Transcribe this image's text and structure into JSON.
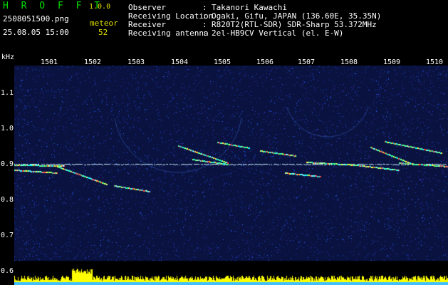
{
  "header": {
    "app_name": "H R O F F T",
    "version": "1.0.0",
    "filename": "2508051500.png",
    "datetime": "25.08.05 15:00",
    "meteor_label": "meteor",
    "meteor_count": "52",
    "info": [
      {
        "key": "Observer",
        "value": "Takanori Kawachi"
      },
      {
        "key": "Receiving Location",
        "value": "Ogaki, Gifu, JAPAN (136.60E, 35.35N)"
      },
      {
        "key": "Receiver",
        "value": "R820T2(RTL-SDR) SDR-Sharp 53.372MHz"
      },
      {
        "key": "Receiving antenna",
        "value": "2el-HB9CV Vertical (el. E-W)"
      }
    ],
    "separator": ":"
  },
  "axis": {
    "y_unit": "kHz",
    "x_ticks": [
      "1501",
      "1502",
      "1503",
      "1504",
      "1505",
      "1506",
      "1507",
      "1508",
      "1509",
      "1510"
    ],
    "y_ticks": [
      "1.1",
      "1.0",
      "0.9",
      "0.8",
      "0.7",
      "0.6"
    ]
  },
  "colors": {
    "background": "#000000",
    "spectrogram_bg": "#0a1240",
    "header_text": "#ffffff",
    "app_name": "#00e000",
    "accent_yellow": "#e0e000",
    "carrier": "#c8f0ff",
    "signal_bars": "#ffff00"
  }
}
